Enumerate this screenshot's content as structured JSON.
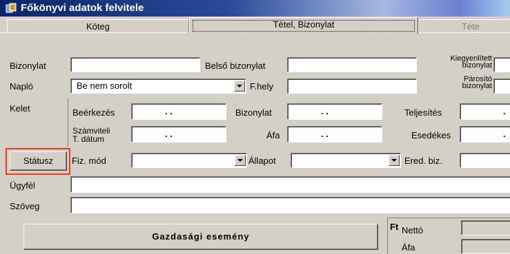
{
  "window": {
    "title": "Főkönyvi adatok felvitele",
    "icon": "ledger-app-icon"
  },
  "tabs": [
    "Köteg",
    "Tétel, Bizonylat",
    "Téte"
  ],
  "active_tab": "Tétel, Bizonylat",
  "fields": {
    "bizonylat": {
      "label": "Bizonylat",
      "value": ""
    },
    "belso_bizonylat": {
      "label": "Belső bizonylat",
      "value": ""
    },
    "kiegyenlitett": {
      "label_line1": "Kiegyenlített",
      "label_line2": "bizonylat",
      "value": ""
    },
    "naplo": {
      "label": "Napló",
      "value": "Be nem sorolt"
    },
    "fhely": {
      "label": "F.hely",
      "value": ""
    },
    "parosito": {
      "label_line1": "Párosító",
      "label_line2": "bizonylat",
      "value": ""
    },
    "kelet": {
      "label": "Kelet"
    },
    "beerkezes": {
      "label": "Beérkezés",
      "value": ". ."
    },
    "bizonylat_date": {
      "label": "Bizonylat",
      "value": ". ."
    },
    "teljesites": {
      "label": "Teljesítés",
      "value": "."
    },
    "szamviteli": {
      "label_line1": "Számviteli",
      "label_line2": "T. dátum",
      "value": ". ."
    },
    "afa_date": {
      "label": "Áfa",
      "value": ". ."
    },
    "esedekes": {
      "label": "Esedékes",
      "value": "."
    },
    "statusz_button": "Státusz",
    "fiz_mod": {
      "label": "Fiz. mód",
      "value": ""
    },
    "allapot": {
      "label": "Állapot",
      "value": ""
    },
    "ered_biz": {
      "label": "Ered. biz.",
      "value": ""
    },
    "ugyfel": {
      "label": "Ügyfél",
      "value": ""
    },
    "szoveg": {
      "label": "Szöveg",
      "value": ""
    }
  },
  "gazdasagi_button": "Gazdasági esemény",
  "amounts": {
    "currency": "Ft",
    "netto_label": "Nettó",
    "afa_label": "Áfa"
  },
  "highlight_color": "#f03a17"
}
